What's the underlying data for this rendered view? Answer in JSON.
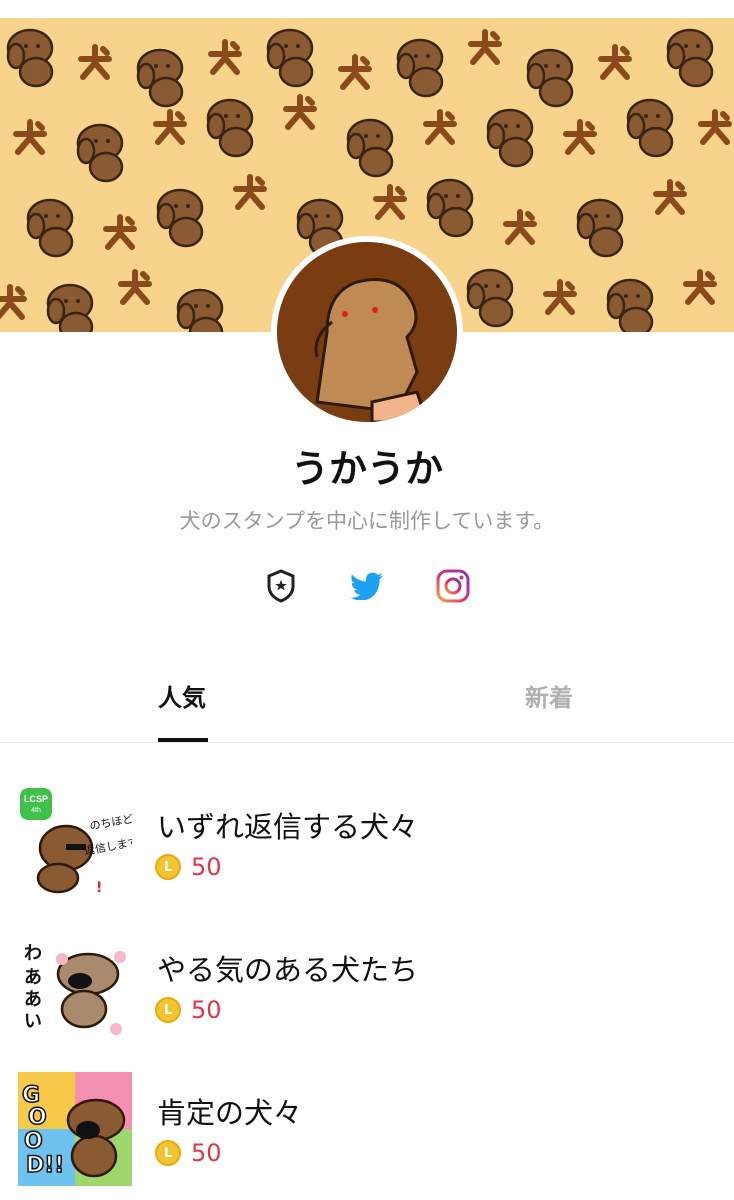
{
  "profile": {
    "name": "うかうか",
    "bio": "犬のスタンプを中心に制作しています。"
  },
  "socials": [
    {
      "icon": "shield-star-icon"
    },
    {
      "icon": "twitter-icon",
      "color": "#1da1f2"
    },
    {
      "icon": "instagram-icon"
    }
  ],
  "tabs": {
    "popular": "人気",
    "new": "新着",
    "active": "popular"
  },
  "items": [
    {
      "title": "いずれ返信する犬々",
      "price": "50",
      "coin_label": "L",
      "badge": "LCSP",
      "badge_sub": "4th",
      "thumb_text": "のちほど返信します"
    },
    {
      "title": "やる気のある犬たち",
      "price": "50",
      "coin_label": "L",
      "thumb_text": "わあああい"
    },
    {
      "title": "肯定の犬々",
      "price": "50",
      "coin_label": "L",
      "thumb_text": "GOOD!!"
    }
  ],
  "colors": {
    "banner_bg": "#f7d38c",
    "dog_brown": "#8a5a32",
    "price_red": "#e0344b",
    "coin_gold": "#f4c430"
  }
}
